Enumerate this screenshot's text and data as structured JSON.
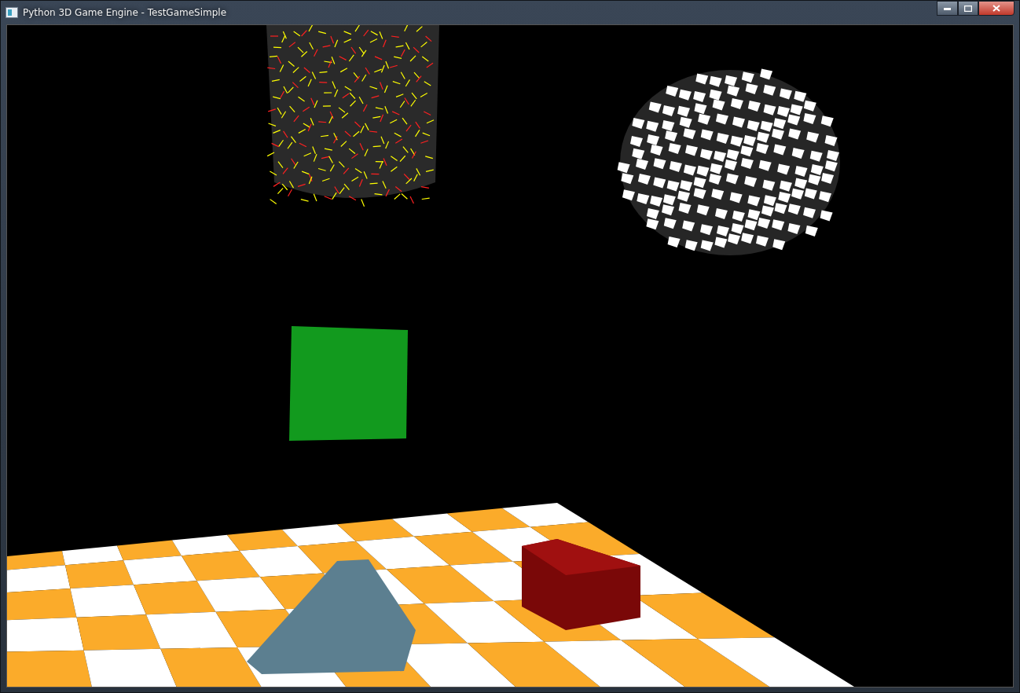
{
  "window": {
    "title": "Python 3D Game Engine - TestGameSimple"
  }
}
